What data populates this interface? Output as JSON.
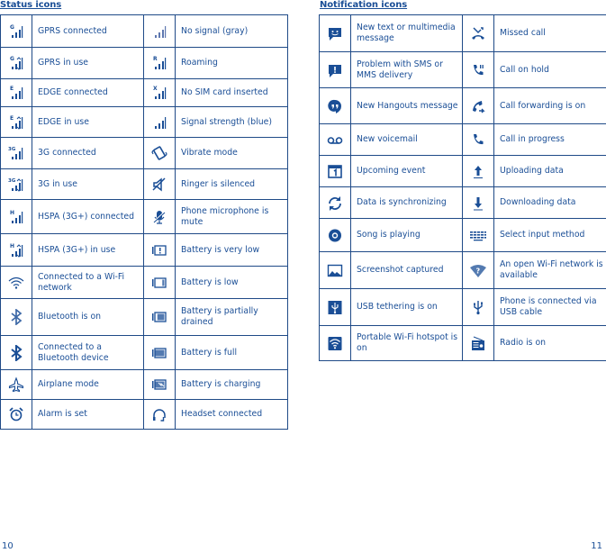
{
  "status": {
    "title": "Status icons",
    "rows": [
      [
        {
          "icon": "gprs-connected-icon",
          "label": "GPRS connected"
        },
        {
          "icon": "no-signal-icon",
          "label": "No signal (gray)"
        }
      ],
      [
        {
          "icon": "gprs-in-use-icon",
          "label": "GPRS in use"
        },
        {
          "icon": "roaming-icon",
          "label": "Roaming"
        }
      ],
      [
        {
          "icon": "edge-connected-icon",
          "label": "EDGE connected"
        },
        {
          "icon": "no-sim-icon",
          "label": "No SIM card inserted"
        }
      ],
      [
        {
          "icon": "edge-in-use-icon",
          "label": "EDGE in use"
        },
        {
          "icon": "signal-strength-icon",
          "label": "Signal strength (blue)"
        }
      ],
      [
        {
          "icon": "3g-connected-icon",
          "label": "3G connected"
        },
        {
          "icon": "vibrate-icon",
          "label": "Vibrate mode"
        }
      ],
      [
        {
          "icon": "3g-in-use-icon",
          "label": "3G in use"
        },
        {
          "icon": "ringer-silenced-icon",
          "label": "Ringer is silenced"
        }
      ],
      [
        {
          "icon": "hspa-connected-icon",
          "label": "HSPA (3G+) connected"
        },
        {
          "icon": "mic-mute-icon",
          "label": "Phone microphone is mute"
        }
      ],
      [
        {
          "icon": "hspa-in-use-icon",
          "label": "HSPA (3G+) in use"
        },
        {
          "icon": "battery-very-low-icon",
          "label": "Battery is very low"
        }
      ],
      [
        {
          "icon": "wifi-connected-icon",
          "label": "Connected to a Wi-Fi network"
        },
        {
          "icon": "battery-low-icon",
          "label": "Battery is low"
        }
      ],
      [
        {
          "icon": "bluetooth-on-icon",
          "label": "Bluetooth is on"
        },
        {
          "icon": "battery-partial-icon",
          "label": "Battery is partially drained"
        }
      ],
      [
        {
          "icon": "bluetooth-connected-icon",
          "label": "Connected to a Bluetooth device"
        },
        {
          "icon": "battery-full-icon",
          "label": "Battery is full"
        }
      ],
      [
        {
          "icon": "airplane-icon",
          "label": "Airplane mode"
        },
        {
          "icon": "battery-charging-icon",
          "label": "Battery is charging"
        }
      ],
      [
        {
          "icon": "alarm-icon",
          "label": "Alarm is set"
        },
        {
          "icon": "headset-icon",
          "label": "Headset connected"
        }
      ]
    ]
  },
  "notification": {
    "title": "Notification icons",
    "rows": [
      [
        {
          "icon": "new-message-icon",
          "label": "New text or multimedia message"
        },
        {
          "icon": "missed-call-icon",
          "label": "Missed call"
        }
      ],
      [
        {
          "icon": "sms-problem-icon",
          "label": "Problem with SMS or MMS delivery"
        },
        {
          "icon": "call-hold-icon",
          "label": "Call on hold"
        }
      ],
      [
        {
          "icon": "hangouts-icon",
          "label": "New Hangouts message"
        },
        {
          "icon": "call-forwarding-icon",
          "label": "Call forwarding is on"
        }
      ],
      [
        {
          "icon": "voicemail-icon",
          "label": "New voicemail"
        },
        {
          "icon": "call-progress-icon",
          "label": "Call in progress"
        }
      ],
      [
        {
          "icon": "calendar-icon",
          "label": "Upcoming event"
        },
        {
          "icon": "upload-icon",
          "label": "Uploading data"
        }
      ],
      [
        {
          "icon": "sync-icon",
          "label": "Data is synchronizing"
        },
        {
          "icon": "download-icon",
          "label": "Downloading data"
        }
      ],
      [
        {
          "icon": "song-playing-icon",
          "label": "Song is playing"
        },
        {
          "icon": "keyboard-icon",
          "label": "Select input method"
        }
      ],
      [
        {
          "icon": "screenshot-icon",
          "label": "Screenshot captured"
        },
        {
          "icon": "open-wifi-icon",
          "label": "An open Wi-Fi network is available"
        }
      ],
      [
        {
          "icon": "usb-tethering-icon",
          "label": "USB tethering is on"
        },
        {
          "icon": "usb-icon",
          "label": "Phone is connected via USB cable"
        }
      ],
      [
        {
          "icon": "hotspot-icon",
          "label": "Portable Wi-Fi hotspot is on"
        },
        {
          "icon": "radio-icon",
          "label": "Radio is on"
        }
      ]
    ]
  },
  "pages": {
    "left": "10",
    "right": "11"
  },
  "colors": {
    "text": "#1a4e96",
    "border": "#1f4a87",
    "icon_gray": "#6b7fae"
  }
}
